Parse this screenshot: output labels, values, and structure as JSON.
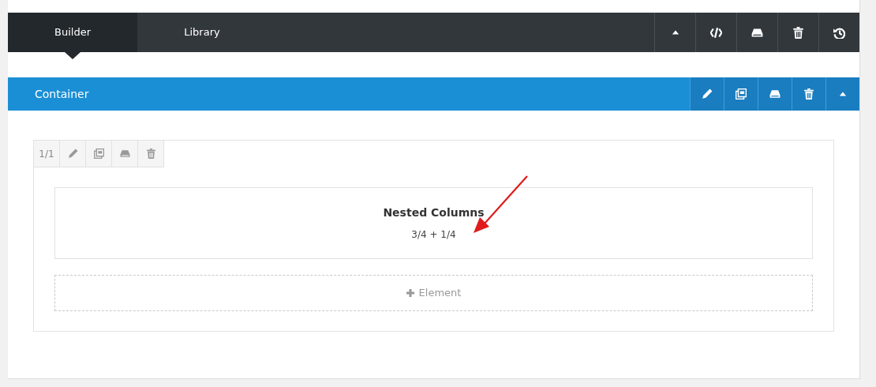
{
  "tabs": [
    {
      "label": "Builder",
      "selected": true
    },
    {
      "label": "Library",
      "selected": false
    }
  ],
  "container": {
    "title": "Container"
  },
  "column": {
    "size": "1/1",
    "element": {
      "title": "Nested Columns",
      "subtitle": "3/4 + 1/4"
    },
    "add_label": "Element"
  }
}
